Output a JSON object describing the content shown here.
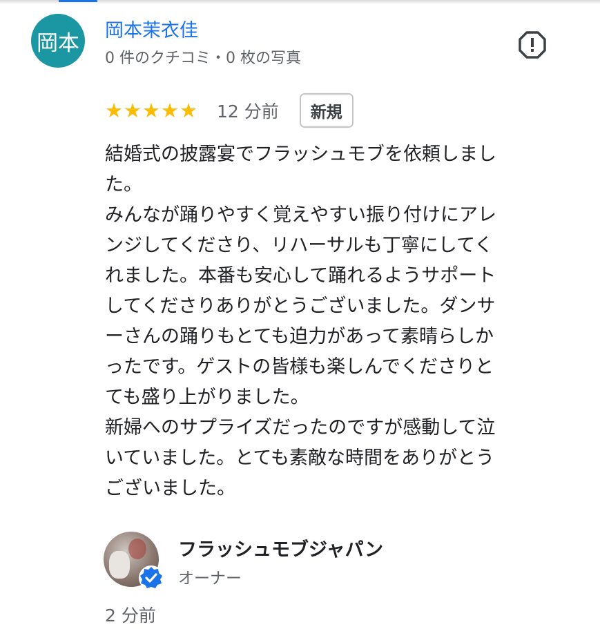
{
  "review": {
    "author": {
      "avatar_text": "岡本",
      "name": "岡本茉衣佳",
      "stats": "0 件のクチコミ・0 枚の写真"
    },
    "rating": 5,
    "rating_stars": "★★★★★",
    "time": "12 分前",
    "badge": "新規",
    "report_icon": "report-icon",
    "text_lines": [
      "結婚式の披露宴でフラッシュモブを依頼しまし",
      "た。",
      "みんなが踊りやすく覚えやすい振り付けにアレ",
      "ンジしてくださり、リハーサルも丁寧にしてく",
      "れました。本番も安心して踊れるようサポート",
      "してくださりありがとうございました。ダンサ",
      "ーさんの踊りもとても迫力があって素晴らしか",
      "ったです。ゲストの皆様も楽しんでくださりと",
      "ても盛り上がりました。",
      "新婦へのサプライズだったのですが感動して泣",
      "いていました。とても素敵な時間をありがとう",
      "ございました。"
    ]
  },
  "owner_reply": {
    "name": "フラッシュモブジャパン",
    "role": "オーナー",
    "time": "2 分前",
    "verified_icon": "verified-badge-icon"
  },
  "colors": {
    "avatar_bg": "#1b97a3",
    "link_blue": "#1a73e8",
    "star_yellow": "#fbbc04",
    "secondary_text": "#5f6368"
  }
}
